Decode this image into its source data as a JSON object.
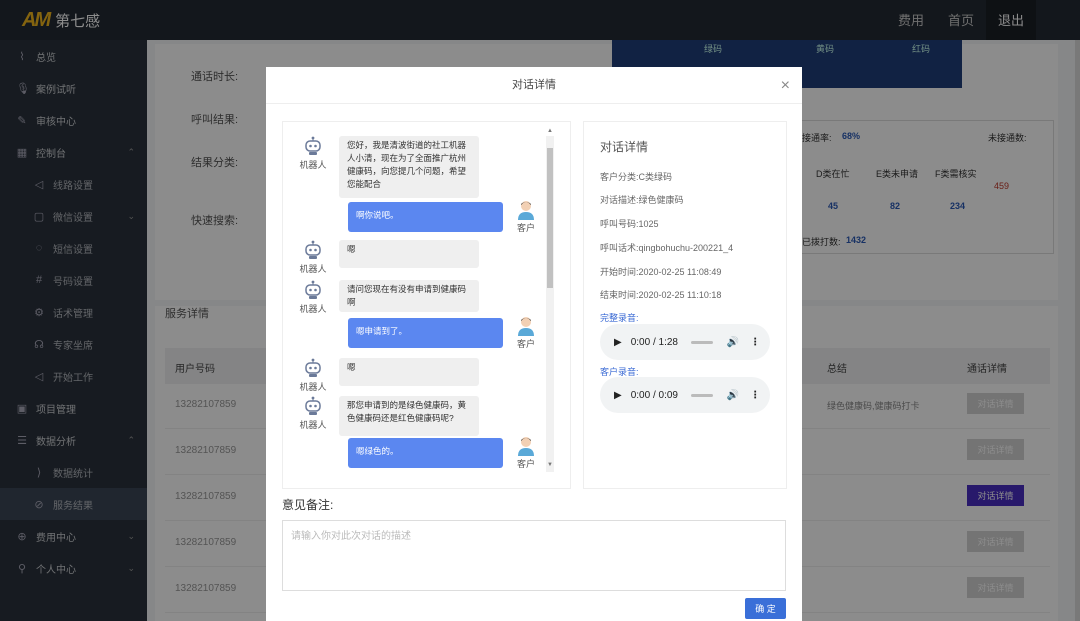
{
  "header": {
    "logo_mark": "AM",
    "logo_name": "第七感",
    "nav": [
      "费用",
      "首页",
      "退出"
    ]
  },
  "sidebar": {
    "items": [
      {
        "label": "总览",
        "icon": "pulse-icon",
        "sub": false
      },
      {
        "label": "案例试听",
        "icon": "mic-icon",
        "sub": false
      },
      {
        "label": "审核中心",
        "icon": "edit-icon",
        "sub": false
      },
      {
        "label": "控制台",
        "icon": "grid-icon",
        "sub": false,
        "chevron": "⌃"
      },
      {
        "label": "线路设置",
        "icon": "speaker-icon",
        "sub": true
      },
      {
        "label": "微信设置",
        "icon": "square-icon",
        "sub": true,
        "chevron": "⌄"
      },
      {
        "label": "短信设置",
        "icon": "message-icon",
        "sub": true
      },
      {
        "label": "号码设置",
        "icon": "hash-icon",
        "sub": true
      },
      {
        "label": "话术管理",
        "icon": "gear-icon",
        "sub": true
      },
      {
        "label": "专家坐席",
        "icon": "headset-icon",
        "sub": true
      },
      {
        "label": "开始工作",
        "icon": "speaker-icon",
        "sub": true
      },
      {
        "label": "项目管理",
        "icon": "folder-icon",
        "sub": false
      },
      {
        "label": "数据分析",
        "icon": "list-icon",
        "sub": false,
        "chevron": "⌃"
      },
      {
        "label": "数据统计",
        "icon": "arc-icon",
        "sub": true
      },
      {
        "label": "服务结果",
        "icon": "link-icon",
        "sub": true,
        "active": true
      },
      {
        "label": "费用中心",
        "icon": "coin-icon",
        "sub": false,
        "chevron": "⌄"
      },
      {
        "label": "个人中心",
        "icon": "user-icon",
        "sub": false,
        "chevron": "⌄"
      }
    ]
  },
  "background": {
    "form_labels": [
      "通话时长:",
      "呼叫结果:",
      "结果分类:",
      "快速搜索:"
    ],
    "banner_labels": [
      "绿码",
      "黄码",
      "红码"
    ],
    "stat_rate_label": "接通率:",
    "stat_rate_value": "68%",
    "stat_unconnected_label": "未接通数:",
    "stat_unconnected_value": "459",
    "stat_cols": [
      "D类在忙",
      "E类未申请",
      "F类需核实"
    ],
    "stat_values": [
      "45",
      "82",
      "234"
    ],
    "stat_dialed_label": "已拨打数:",
    "stat_dialed_value": "1432",
    "service_title": "服务详情",
    "table_headers": [
      "用户号码",
      "总结",
      "通话详情"
    ],
    "rows": [
      {
        "phone": "13282107859",
        "summary": "绿色健康码,健康码打卡",
        "btn": "对话详情"
      },
      {
        "phone": "13282107859",
        "summary": "",
        "btn": "对话详情"
      },
      {
        "phone": "13282107859",
        "summary": "",
        "btn": "对话详情"
      },
      {
        "phone": "13282107859",
        "summary": "",
        "btn": "对话详情"
      },
      {
        "phone": "13282107859",
        "summary": "",
        "btn": "对话详情"
      }
    ]
  },
  "modal": {
    "title": "对话详情",
    "close": "×",
    "chat": {
      "bot_label": "机器人",
      "user_label": "客户",
      "messages": [
        {
          "from": "bot",
          "text": "您好，我是清波街道的社工机器人小清，现在为了全面推广杭州健康码，向您提几个问题，希望您能配合"
        },
        {
          "from": "user",
          "text": "啊你说吧。"
        },
        {
          "from": "bot",
          "text": "嗯"
        },
        {
          "from": "bot",
          "text": "请问您现在有没有申请到健康码啊"
        },
        {
          "from": "user",
          "text": "嗯申请到了。"
        },
        {
          "from": "bot",
          "text": "嗯"
        },
        {
          "from": "bot",
          "text": "那您申请到的是绿色健康码，黄色健康码还是红色健康码呢?"
        },
        {
          "from": "user",
          "text": "嗯绿色的。"
        }
      ]
    },
    "info": {
      "title": "对话详情",
      "category": "客户分类:C类绿码",
      "description": "对话描述:绿色健康码",
      "phone": "呼叫号码:1025",
      "script": "呼叫话术:qingbohuchu-200221_4",
      "start": "开始时间:2020-02-25 11:08:49",
      "end": "结束时间:2020-02-25 11:10:18",
      "full_recording_label": "完整录音:",
      "full_recording_time": "0:00 / 1:28",
      "customer_recording_label": "客户录音:",
      "customer_recording_time": "0:00 / 0:09"
    },
    "remark_label": "意见备注:",
    "remark_placeholder": "请输入你对此次对话的描述",
    "confirm": "确 定"
  }
}
